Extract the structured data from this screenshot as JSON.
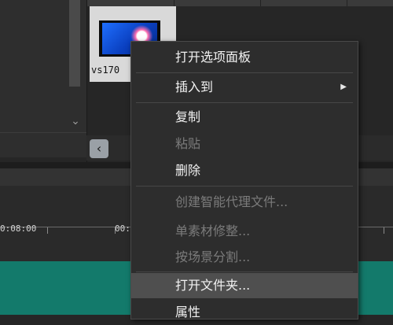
{
  "library": {
    "clip_name": "vs170"
  },
  "timeline": {
    "timecode_1": "0:08:00",
    "timecode_2": "00:"
  },
  "context_menu": {
    "items": [
      {
        "label": "打开选项面板",
        "enabled": true
      },
      {
        "label": "插入到",
        "enabled": true,
        "submenu": true
      },
      {
        "label": "复制",
        "enabled": true
      },
      {
        "label": "粘贴",
        "enabled": false
      },
      {
        "label": "删除",
        "enabled": true
      },
      {
        "label": "创建智能代理文件...",
        "enabled": false
      },
      {
        "label": "单素材修整...",
        "enabled": false
      },
      {
        "label": "按场景分割...",
        "enabled": false
      },
      {
        "label": "打开文件夹...",
        "enabled": true,
        "highlighted": true
      },
      {
        "label": "属性",
        "enabled": true
      }
    ]
  },
  "icons": {
    "chevron": "chevron-down-icon",
    "scroll_left": "chevron-left-icon",
    "submenu": "submenu-arrow-icon"
  },
  "colors": {
    "track": "#137a6b",
    "menu_bg": "#2d2d2d",
    "menu_highlight": "#4f4f4f"
  }
}
